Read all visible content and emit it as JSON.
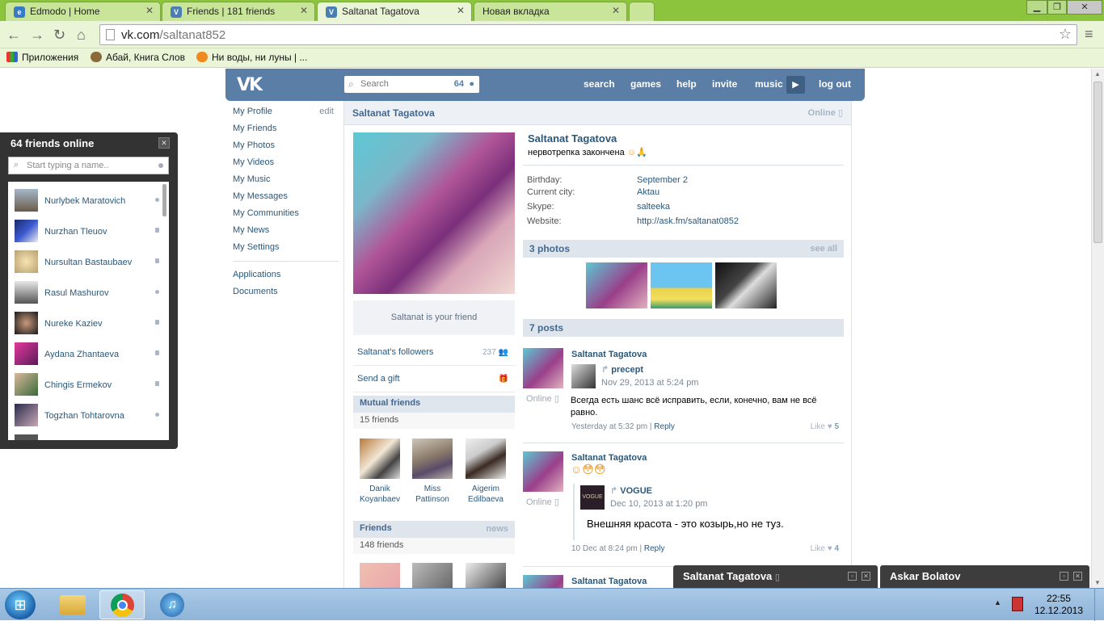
{
  "browser": {
    "tabs": [
      {
        "title": "Edmodo | Home",
        "favicon": "edmodo-icon"
      },
      {
        "title": "Friends | 181 friends",
        "favicon": "vk-icon"
      },
      {
        "title": "Saltanat Tagatova",
        "favicon": "vk-icon"
      },
      {
        "title": "Новая вкладка",
        "favicon": ""
      }
    ],
    "url_domain": "vk.com",
    "url_path": "/saltanat852",
    "bookmarks": [
      "Приложения",
      "Абай, Книга Слов",
      "Ни воды, ни луны | ..."
    ]
  },
  "vk_header": {
    "logo": "VK",
    "search_placeholder": "Search",
    "search_online_count": "64",
    "nav": [
      "search",
      "games",
      "help",
      "invite",
      "music",
      "log out"
    ]
  },
  "left_menu": {
    "items": [
      "My Profile",
      "My Friends",
      "My Photos",
      "My Videos",
      "My Music",
      "My Messages",
      "My Communities",
      "My News",
      "My Settings"
    ],
    "edit_label": "edit",
    "extra": [
      "Applications",
      "Documents"
    ]
  },
  "profile": {
    "page_title": "Saltanat Tagatova",
    "online_label": "Online",
    "name": "Saltanat Tagatova",
    "status": "нервотрепка закончена",
    "status_emoji": "☺🙏",
    "info": [
      {
        "key": "Birthday:",
        "value": "September 2"
      },
      {
        "key": "Current city:",
        "value": "Aktau"
      },
      {
        "key": "Skype:",
        "value": "salteeka"
      },
      {
        "key": "Website:",
        "value": "http://ask.fm/saltanat0852"
      }
    ],
    "friend_status": "Saltanat is your friend",
    "followers_label": "Saltanat's followers",
    "followers_count": "237",
    "gift_label": "Send a gift",
    "mutual_title": "Mutual friends",
    "mutual_count": "15 friends",
    "mutual_friends": [
      {
        "first": "Danik",
        "last": "Koyanbaev"
      },
      {
        "first": "Miss",
        "last": "Pattinson"
      },
      {
        "first": "Aigerim",
        "last": "Edilbaeva"
      }
    ],
    "friends_title": "Friends",
    "friends_news": "news",
    "friends_count": "148 friends",
    "photos_title": "3 photos",
    "photos_see_all": "see all",
    "posts_title": "7 posts"
  },
  "posts": [
    {
      "author": "Saltanat Tagatova",
      "online": "Online",
      "repost_from": "precept",
      "repost_date": "Nov 29, 2013 at 5:24 pm",
      "text": "Всегда есть шанс всё исправить, если, конечно, вам не всё равно.",
      "meta_date": "Yesterday at 5:32 pm",
      "reply": "Reply",
      "like_label": "Like",
      "like_count": "5"
    },
    {
      "author": "Saltanat Tagatova",
      "online": "Online",
      "emoji": "☺😳😳",
      "repost_from": "VOGUE",
      "repost_date": "Dec 10, 2013 at 1:20 pm",
      "text": "Внешняя красота - это козырь,но не туз.",
      "meta_date": "10 Dec at 8:24 pm",
      "reply": "Reply",
      "like_label": "Like",
      "like_count": "4"
    },
    {
      "author": "Saltanat Tagatova"
    }
  ],
  "online_panel": {
    "title": "64 friends online",
    "placeholder": "Start typing a name..",
    "friends": [
      {
        "name": "Nurlybek Maratovich",
        "status": "web"
      },
      {
        "name": "Nurzhan Tleuov",
        "status": "mobile"
      },
      {
        "name": "Nursultan Bastaubaev",
        "status": "mobile"
      },
      {
        "name": "Rasul Mashurov",
        "status": "web"
      },
      {
        "name": "Nureke Kaziev",
        "status": "mobile"
      },
      {
        "name": "Aydana Zhantaeva",
        "status": "mobile"
      },
      {
        "name": "Chingis Ermekov",
        "status": "mobile"
      },
      {
        "name": "Togzhan Tohtarovna",
        "status": "web"
      }
    ]
  },
  "chat_tabs": [
    "Saltanat Tagatova",
    "Askar Bolatov"
  ],
  "taskbar": {
    "time": "22:55",
    "date": "12.12.2013"
  },
  "colors": {
    "vk_blue": "#5a7ea5",
    "link": "#2b587a",
    "chrome_green": "#8dc43e"
  }
}
